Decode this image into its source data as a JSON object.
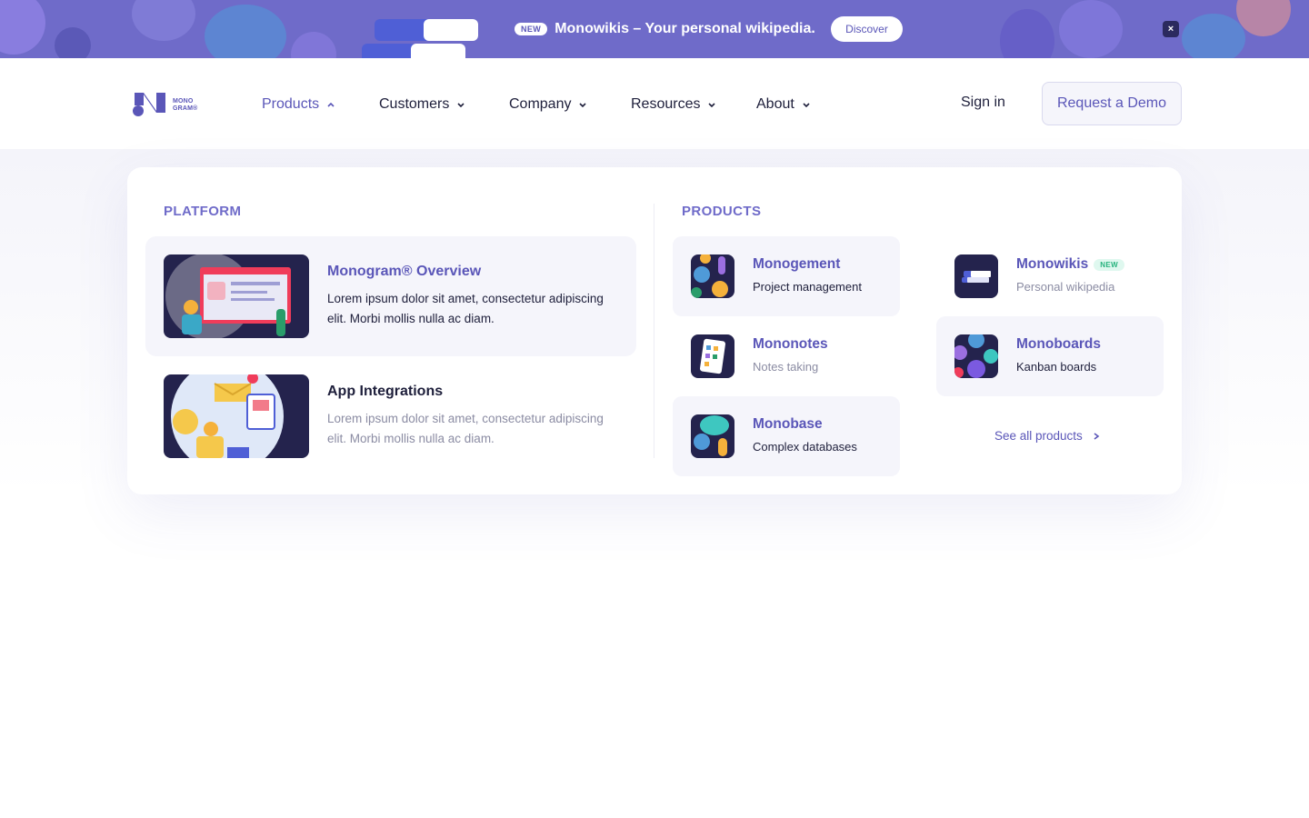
{
  "banner": {
    "new_label": "NEW",
    "message": "Monowikis – Your personal wikipedia.",
    "discover_label": "Discover",
    "close_glyph": "×",
    "background": "#6f6bc9"
  },
  "header": {
    "logo_line1": "MONO",
    "logo_line2": "GRAM®",
    "nav": [
      {
        "label": "Products",
        "active": true
      },
      {
        "label": "Customers",
        "active": false
      },
      {
        "label": "Company",
        "active": false
      },
      {
        "label": "Resources",
        "active": false
      },
      {
        "label": "About",
        "active": false
      }
    ],
    "sign_in": "Sign in",
    "demo": "Request a Demo"
  },
  "menu": {
    "platform_label": "PLATFORM",
    "products_label": "PRODUCTS",
    "platform": [
      {
        "title": "Monogram® Overview",
        "desc": "Lorem ipsum dolor sit amet, consectetur adipiscing elit. Morbi mollis nulla ac diam."
      },
      {
        "title": "App Integrations",
        "desc": "Lorem ipsum dolor sit amet, consectetur adipiscing elit. Morbi mollis nulla ac diam."
      }
    ],
    "products": [
      {
        "name": "Monogement",
        "sub": "Project management"
      },
      {
        "name": "Mononotes",
        "sub": "Notes taking"
      },
      {
        "name": "Monobase",
        "sub": "Complex databases"
      },
      {
        "name": "Monowikis",
        "sub": "Personal wikipedia",
        "badge": "NEW"
      },
      {
        "name": "Monoboards",
        "sub": "Kanban boards"
      }
    ],
    "see_all": "See all products"
  },
  "colors": {
    "accent": "#5a56b8",
    "text": "#1e1f3b",
    "muted": "#8b8ca3",
    "highlight": "#f5f5fb",
    "new_green": "#27b37e"
  }
}
